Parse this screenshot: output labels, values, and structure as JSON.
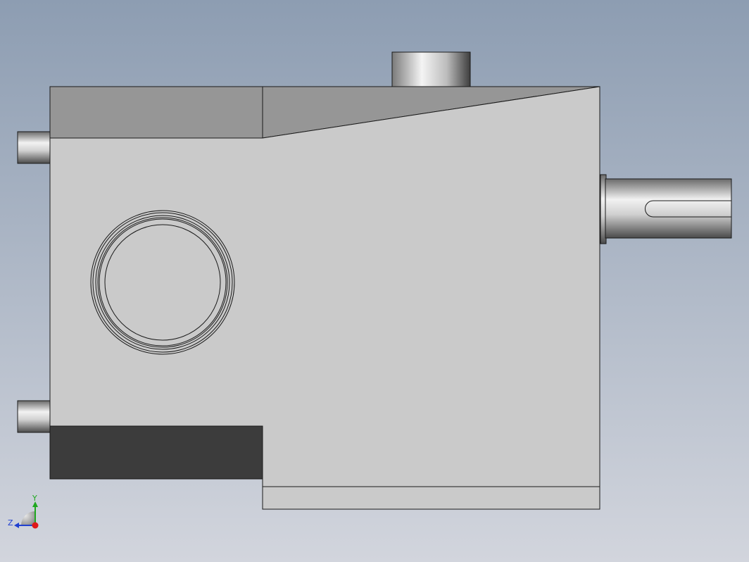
{
  "viewport": {
    "background_top": "#8d9db2",
    "background_bottom": "#d2d5dd"
  },
  "model": {
    "colors": {
      "body_face": "#cacaca",
      "top_chamfer": "#969696",
      "dark_block": "#3c3c3c",
      "outline": "#1a1a1a",
      "shaft_light": "#f0f0f0",
      "shaft_dark": "#5a5a5a"
    }
  },
  "triad": {
    "y_label": "Y",
    "z_label": "Z",
    "y_color": "#1fa81f",
    "z_color": "#2040d0",
    "x_color": "#e01818"
  }
}
